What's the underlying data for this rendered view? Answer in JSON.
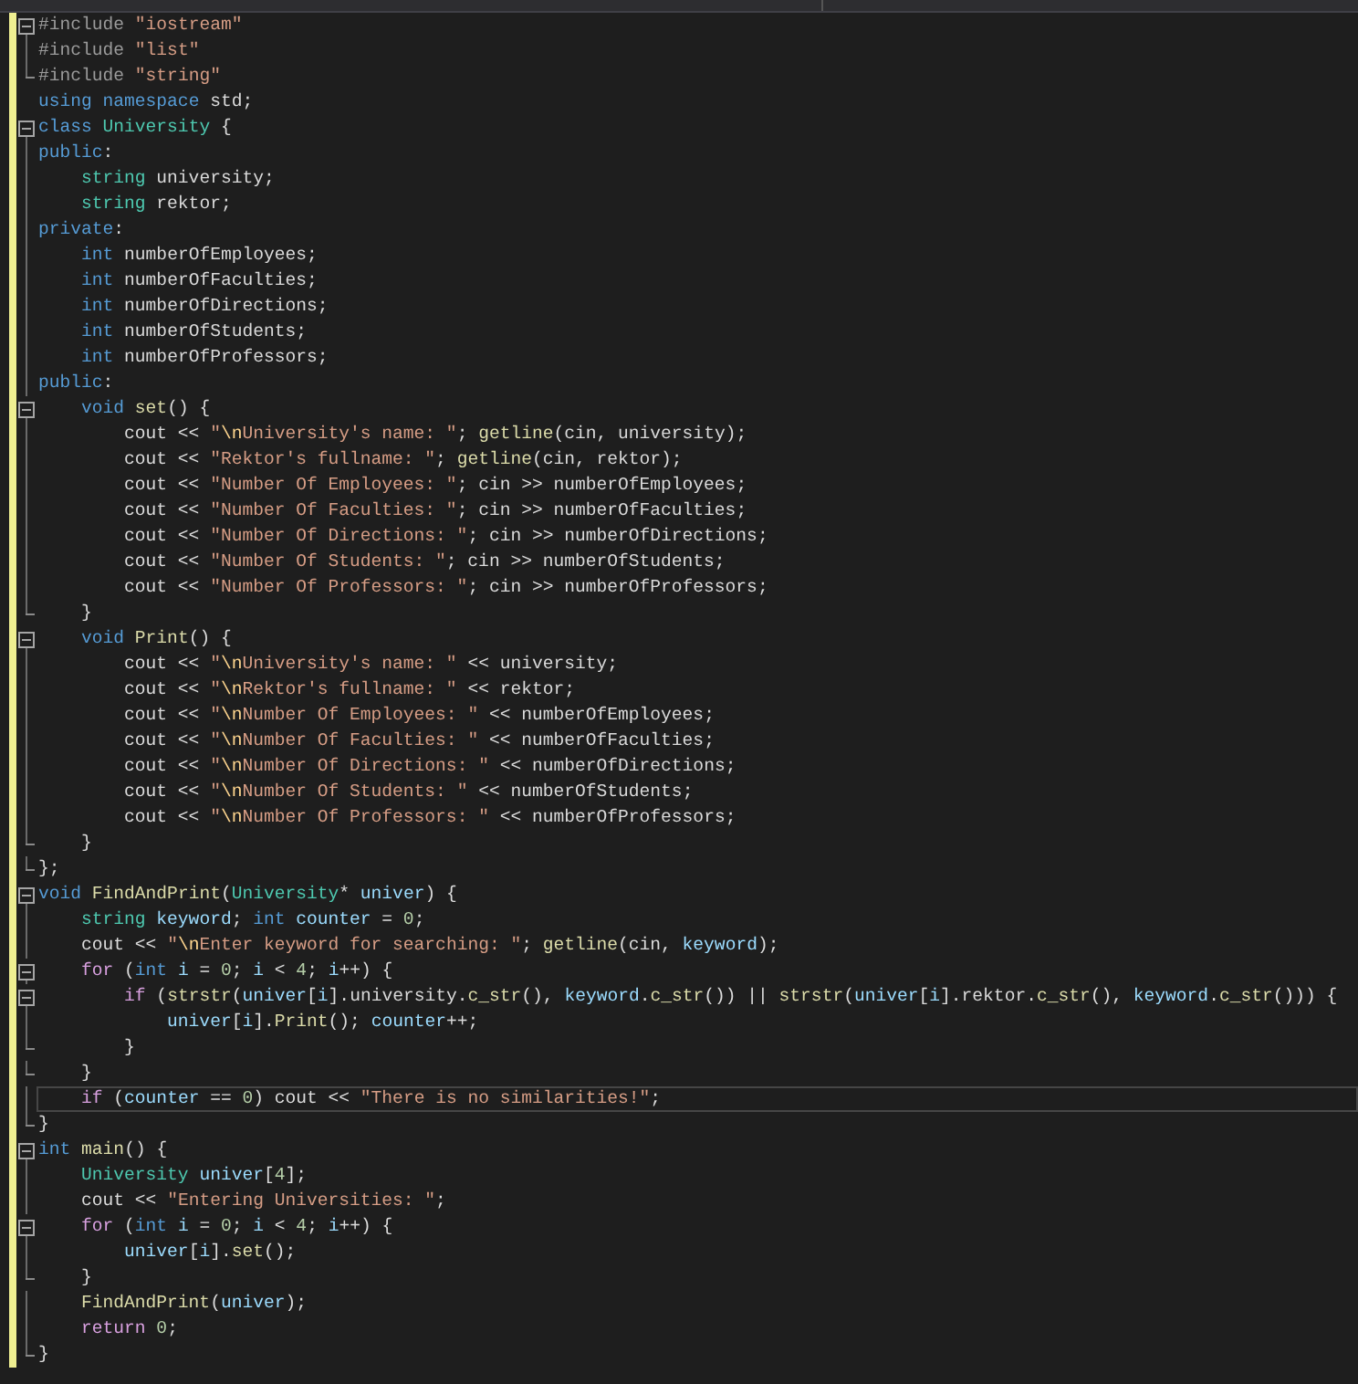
{
  "lines": [
    {
      "collapsible": true,
      "in_block": true,
      "block_end": false,
      "modified": true,
      "current": false,
      "tokens": [
        {
          "kind": "pre",
          "text": "#include "
        },
        {
          "kind": "str",
          "text": "\"iostream\""
        }
      ]
    },
    {
      "collapsible": false,
      "in_block": true,
      "block_end": false,
      "modified": true,
      "current": false,
      "tokens": [
        {
          "kind": "pre",
          "text": "#include "
        },
        {
          "kind": "str",
          "text": "\"list\""
        }
      ]
    },
    {
      "collapsible": false,
      "in_block": true,
      "block_end": true,
      "modified": true,
      "current": false,
      "tokens": [
        {
          "kind": "pre",
          "text": "#include "
        },
        {
          "kind": "str",
          "text": "\"string\""
        }
      ]
    },
    {
      "collapsible": false,
      "in_block": false,
      "block_end": false,
      "modified": true,
      "current": false,
      "tokens": [
        {
          "kind": "kw",
          "text": "using "
        },
        {
          "kind": "kw",
          "text": "namespace"
        },
        {
          "kind": "p",
          "text": " std;"
        }
      ]
    },
    {
      "collapsible": true,
      "in_block": true,
      "block_end": false,
      "modified": true,
      "current": false,
      "tokens": [
        {
          "kind": "kw",
          "text": "class "
        },
        {
          "kind": "type",
          "text": "University"
        },
        {
          "kind": "p",
          "text": " {"
        }
      ]
    },
    {
      "collapsible": false,
      "in_block": true,
      "block_end": false,
      "modified": true,
      "current": false,
      "tokens": [
        {
          "kind": "kw",
          "text": "public"
        },
        {
          "kind": "p",
          "text": ":"
        }
      ]
    },
    {
      "collapsible": false,
      "in_block": true,
      "block_end": false,
      "modified": true,
      "current": false,
      "tokens": [
        {
          "kind": "type",
          "text": "    string "
        },
        {
          "kind": "mem",
          "text": "university"
        },
        {
          "kind": "p",
          "text": ";"
        }
      ]
    },
    {
      "collapsible": false,
      "in_block": true,
      "block_end": false,
      "modified": true,
      "current": false,
      "tokens": [
        {
          "kind": "type",
          "text": "    string "
        },
        {
          "kind": "mem",
          "text": "rektor"
        },
        {
          "kind": "p",
          "text": ";"
        }
      ]
    },
    {
      "collapsible": false,
      "in_block": true,
      "block_end": false,
      "modified": true,
      "current": false,
      "tokens": [
        {
          "kind": "kw",
          "text": "private"
        },
        {
          "kind": "p",
          "text": ":"
        }
      ]
    },
    {
      "collapsible": false,
      "in_block": true,
      "block_end": false,
      "modified": true,
      "current": false,
      "tokens": [
        {
          "kind": "kw",
          "text": "    int "
        },
        {
          "kind": "mem",
          "text": "numberOfEmployees"
        },
        {
          "kind": "p",
          "text": ";"
        }
      ]
    },
    {
      "collapsible": false,
      "in_block": true,
      "block_end": false,
      "modified": true,
      "current": false,
      "tokens": [
        {
          "kind": "kw",
          "text": "    int "
        },
        {
          "kind": "mem",
          "text": "numberOfFaculties"
        },
        {
          "kind": "p",
          "text": ";"
        }
      ]
    },
    {
      "collapsible": false,
      "in_block": true,
      "block_end": false,
      "modified": true,
      "current": false,
      "tokens": [
        {
          "kind": "kw",
          "text": "    int "
        },
        {
          "kind": "mem",
          "text": "numberOfDirections"
        },
        {
          "kind": "p",
          "text": ";"
        }
      ]
    },
    {
      "collapsible": false,
      "in_block": true,
      "block_end": false,
      "modified": true,
      "current": false,
      "tokens": [
        {
          "kind": "kw",
          "text": "    int "
        },
        {
          "kind": "mem",
          "text": "numberOfStudents"
        },
        {
          "kind": "p",
          "text": ";"
        }
      ]
    },
    {
      "collapsible": false,
      "in_block": true,
      "block_end": false,
      "modified": true,
      "current": false,
      "tokens": [
        {
          "kind": "kw",
          "text": "    int "
        },
        {
          "kind": "mem",
          "text": "numberOfProfessors"
        },
        {
          "kind": "p",
          "text": ";"
        }
      ]
    },
    {
      "collapsible": false,
      "in_block": true,
      "block_end": false,
      "modified": true,
      "current": false,
      "tokens": [
        {
          "kind": "kw",
          "text": "public"
        },
        {
          "kind": "p",
          "text": ":"
        }
      ]
    },
    {
      "collapsible": true,
      "in_block": true,
      "block_end": false,
      "modified": true,
      "current": false,
      "tokens": [
        {
          "kind": "kw",
          "text": "    void "
        },
        {
          "kind": "fn",
          "text": "set"
        },
        {
          "kind": "p",
          "text": "() {"
        }
      ]
    },
    {
      "collapsible": false,
      "in_block": true,
      "block_end": false,
      "modified": true,
      "current": false,
      "tokens": [
        {
          "kind": "p",
          "text": "        cout << "
        },
        {
          "kind": "str",
          "text": "\""
        },
        {
          "kind": "esc",
          "text": "\\n"
        },
        {
          "kind": "str",
          "text": "University's name: \""
        },
        {
          "kind": "p",
          "text": "; "
        },
        {
          "kind": "fn",
          "text": "getline"
        },
        {
          "kind": "p",
          "text": "(cin, "
        },
        {
          "kind": "mem",
          "text": "university"
        },
        {
          "kind": "p",
          "text": ");"
        }
      ]
    },
    {
      "collapsible": false,
      "in_block": true,
      "block_end": false,
      "modified": true,
      "current": false,
      "tokens": [
        {
          "kind": "p",
          "text": "        cout << "
        },
        {
          "kind": "str",
          "text": "\"Rektor's fullname: \""
        },
        {
          "kind": "p",
          "text": "; "
        },
        {
          "kind": "fn",
          "text": "getline"
        },
        {
          "kind": "p",
          "text": "(cin, "
        },
        {
          "kind": "mem",
          "text": "rektor"
        },
        {
          "kind": "p",
          "text": ");"
        }
      ]
    },
    {
      "collapsible": false,
      "in_block": true,
      "block_end": false,
      "modified": true,
      "current": false,
      "tokens": [
        {
          "kind": "p",
          "text": "        cout << "
        },
        {
          "kind": "str",
          "text": "\"Number Of Employees: \""
        },
        {
          "kind": "p",
          "text": "; cin >> "
        },
        {
          "kind": "mem",
          "text": "numberOfEmployees"
        },
        {
          "kind": "p",
          "text": ";"
        }
      ]
    },
    {
      "collapsible": false,
      "in_block": true,
      "block_end": false,
      "modified": true,
      "current": false,
      "tokens": [
        {
          "kind": "p",
          "text": "        cout << "
        },
        {
          "kind": "str",
          "text": "\"Number Of Faculties: \""
        },
        {
          "kind": "p",
          "text": "; cin >> "
        },
        {
          "kind": "mem",
          "text": "numberOfFaculties"
        },
        {
          "kind": "p",
          "text": ";"
        }
      ]
    },
    {
      "collapsible": false,
      "in_block": true,
      "block_end": false,
      "modified": true,
      "current": false,
      "tokens": [
        {
          "kind": "p",
          "text": "        cout << "
        },
        {
          "kind": "str",
          "text": "\"Number Of Directions: \""
        },
        {
          "kind": "p",
          "text": "; cin >> "
        },
        {
          "kind": "mem",
          "text": "numberOfDirections"
        },
        {
          "kind": "p",
          "text": ";"
        }
      ]
    },
    {
      "collapsible": false,
      "in_block": true,
      "block_end": false,
      "modified": true,
      "current": false,
      "tokens": [
        {
          "kind": "p",
          "text": "        cout << "
        },
        {
          "kind": "str",
          "text": "\"Number Of Students: \""
        },
        {
          "kind": "p",
          "text": "; cin >> "
        },
        {
          "kind": "mem",
          "text": "numberOfStudents"
        },
        {
          "kind": "p",
          "text": ";"
        }
      ]
    },
    {
      "collapsible": false,
      "in_block": true,
      "block_end": false,
      "modified": true,
      "current": false,
      "tokens": [
        {
          "kind": "p",
          "text": "        cout << "
        },
        {
          "kind": "str",
          "text": "\"Number Of Professors: \""
        },
        {
          "kind": "p",
          "text": "; cin >> "
        },
        {
          "kind": "mem",
          "text": "numberOfProfessors"
        },
        {
          "kind": "p",
          "text": ";"
        }
      ]
    },
    {
      "collapsible": false,
      "in_block": true,
      "block_end": true,
      "modified": true,
      "current": false,
      "tokens": [
        {
          "kind": "p",
          "text": "    }"
        }
      ]
    },
    {
      "collapsible": true,
      "in_block": true,
      "block_end": false,
      "modified": true,
      "current": false,
      "tokens": [
        {
          "kind": "kw",
          "text": "    void "
        },
        {
          "kind": "fn",
          "text": "Print"
        },
        {
          "kind": "p",
          "text": "() {"
        }
      ]
    },
    {
      "collapsible": false,
      "in_block": true,
      "block_end": false,
      "modified": true,
      "current": false,
      "tokens": [
        {
          "kind": "p",
          "text": "        cout << "
        },
        {
          "kind": "str",
          "text": "\""
        },
        {
          "kind": "esc",
          "text": "\\n"
        },
        {
          "kind": "str",
          "text": "University's name: \""
        },
        {
          "kind": "p",
          "text": " << "
        },
        {
          "kind": "mem",
          "text": "university"
        },
        {
          "kind": "p",
          "text": ";"
        }
      ]
    },
    {
      "collapsible": false,
      "in_block": true,
      "block_end": false,
      "modified": true,
      "current": false,
      "tokens": [
        {
          "kind": "p",
          "text": "        cout << "
        },
        {
          "kind": "str",
          "text": "\""
        },
        {
          "kind": "esc",
          "text": "\\n"
        },
        {
          "kind": "str",
          "text": "Rektor's fullname: \""
        },
        {
          "kind": "p",
          "text": " << "
        },
        {
          "kind": "mem",
          "text": "rektor"
        },
        {
          "kind": "p",
          "text": ";"
        }
      ]
    },
    {
      "collapsible": false,
      "in_block": true,
      "block_end": false,
      "modified": true,
      "current": false,
      "tokens": [
        {
          "kind": "p",
          "text": "        cout << "
        },
        {
          "kind": "str",
          "text": "\""
        },
        {
          "kind": "esc",
          "text": "\\n"
        },
        {
          "kind": "str",
          "text": "Number Of Employees: \""
        },
        {
          "kind": "p",
          "text": " << "
        },
        {
          "kind": "mem",
          "text": "numberOfEmployees"
        },
        {
          "kind": "p",
          "text": ";"
        }
      ]
    },
    {
      "collapsible": false,
      "in_block": true,
      "block_end": false,
      "modified": true,
      "current": false,
      "tokens": [
        {
          "kind": "p",
          "text": "        cout << "
        },
        {
          "kind": "str",
          "text": "\""
        },
        {
          "kind": "esc",
          "text": "\\n"
        },
        {
          "kind": "str",
          "text": "Number Of Faculties: \""
        },
        {
          "kind": "p",
          "text": " << "
        },
        {
          "kind": "mem",
          "text": "numberOfFaculties"
        },
        {
          "kind": "p",
          "text": ";"
        }
      ]
    },
    {
      "collapsible": false,
      "in_block": true,
      "block_end": false,
      "modified": true,
      "current": false,
      "tokens": [
        {
          "kind": "p",
          "text": "        cout << "
        },
        {
          "kind": "str",
          "text": "\""
        },
        {
          "kind": "esc",
          "text": "\\n"
        },
        {
          "kind": "str",
          "text": "Number Of Directions: \""
        },
        {
          "kind": "p",
          "text": " << "
        },
        {
          "kind": "mem",
          "text": "numberOfDirections"
        },
        {
          "kind": "p",
          "text": ";"
        }
      ]
    },
    {
      "collapsible": false,
      "in_block": true,
      "block_end": false,
      "modified": true,
      "current": false,
      "tokens": [
        {
          "kind": "p",
          "text": "        cout << "
        },
        {
          "kind": "str",
          "text": "\""
        },
        {
          "kind": "esc",
          "text": "\\n"
        },
        {
          "kind": "str",
          "text": "Number Of Students: \""
        },
        {
          "kind": "p",
          "text": " << "
        },
        {
          "kind": "mem",
          "text": "numberOfStudents"
        },
        {
          "kind": "p",
          "text": ";"
        }
      ]
    },
    {
      "collapsible": false,
      "in_block": true,
      "block_end": false,
      "modified": true,
      "current": false,
      "tokens": [
        {
          "kind": "p",
          "text": "        cout << "
        },
        {
          "kind": "str",
          "text": "\""
        },
        {
          "kind": "esc",
          "text": "\\n"
        },
        {
          "kind": "str",
          "text": "Number Of Professors: \""
        },
        {
          "kind": "p",
          "text": " << "
        },
        {
          "kind": "mem",
          "text": "numberOfProfessors"
        },
        {
          "kind": "p",
          "text": ";"
        }
      ]
    },
    {
      "collapsible": false,
      "in_block": true,
      "block_end": true,
      "modified": true,
      "current": false,
      "tokens": [
        {
          "kind": "p",
          "text": "    }"
        }
      ]
    },
    {
      "collapsible": false,
      "in_block": true,
      "block_end": true,
      "modified": true,
      "current": false,
      "tokens": [
        {
          "kind": "p",
          "text": "};"
        }
      ]
    },
    {
      "collapsible": true,
      "in_block": true,
      "block_end": false,
      "modified": true,
      "current": false,
      "tokens": [
        {
          "kind": "kw",
          "text": "void "
        },
        {
          "kind": "fn",
          "text": "FindAndPrint"
        },
        {
          "kind": "p",
          "text": "("
        },
        {
          "kind": "type",
          "text": "University"
        },
        {
          "kind": "p",
          "text": "* "
        },
        {
          "kind": "var",
          "text": "univer"
        },
        {
          "kind": "p",
          "text": ") {"
        }
      ]
    },
    {
      "collapsible": false,
      "in_block": true,
      "block_end": false,
      "modified": true,
      "current": false,
      "tokens": [
        {
          "kind": "type",
          "text": "    string "
        },
        {
          "kind": "var",
          "text": "keyword"
        },
        {
          "kind": "p",
          "text": "; "
        },
        {
          "kind": "kw",
          "text": "int "
        },
        {
          "kind": "var",
          "text": "counter"
        },
        {
          "kind": "p",
          "text": " = "
        },
        {
          "kind": "num",
          "text": "0"
        },
        {
          "kind": "p",
          "text": ";"
        }
      ]
    },
    {
      "collapsible": false,
      "in_block": true,
      "block_end": false,
      "modified": true,
      "current": false,
      "tokens": [
        {
          "kind": "p",
          "text": "    cout << "
        },
        {
          "kind": "str",
          "text": "\""
        },
        {
          "kind": "esc",
          "text": "\\n"
        },
        {
          "kind": "str",
          "text": "Enter keyword for searching: \""
        },
        {
          "kind": "p",
          "text": "; "
        },
        {
          "kind": "fn",
          "text": "getline"
        },
        {
          "kind": "p",
          "text": "(cin, "
        },
        {
          "kind": "var",
          "text": "keyword"
        },
        {
          "kind": "p",
          "text": ");"
        }
      ]
    },
    {
      "collapsible": true,
      "in_block": true,
      "block_end": false,
      "modified": true,
      "current": false,
      "tokens": [
        {
          "kind": "ctrl",
          "text": "    for"
        },
        {
          "kind": "p",
          "text": " ("
        },
        {
          "kind": "kw",
          "text": "int "
        },
        {
          "kind": "var",
          "text": "i"
        },
        {
          "kind": "p",
          "text": " = "
        },
        {
          "kind": "num",
          "text": "0"
        },
        {
          "kind": "p",
          "text": "; "
        },
        {
          "kind": "var",
          "text": "i"
        },
        {
          "kind": "p",
          "text": " < "
        },
        {
          "kind": "num",
          "text": "4"
        },
        {
          "kind": "p",
          "text": "; "
        },
        {
          "kind": "var",
          "text": "i"
        },
        {
          "kind": "p",
          "text": "++) {"
        }
      ]
    },
    {
      "collapsible": true,
      "in_block": true,
      "block_end": false,
      "modified": true,
      "current": false,
      "tokens": [
        {
          "kind": "ctrl",
          "text": "        if"
        },
        {
          "kind": "p",
          "text": " ("
        },
        {
          "kind": "fn",
          "text": "strstr"
        },
        {
          "kind": "p",
          "text": "("
        },
        {
          "kind": "var",
          "text": "univer"
        },
        {
          "kind": "p",
          "text": "["
        },
        {
          "kind": "var",
          "text": "i"
        },
        {
          "kind": "p",
          "text": "]."
        },
        {
          "kind": "mem",
          "text": "university"
        },
        {
          "kind": "p",
          "text": "."
        },
        {
          "kind": "fn",
          "text": "c_str"
        },
        {
          "kind": "p",
          "text": "(), "
        },
        {
          "kind": "var",
          "text": "keyword"
        },
        {
          "kind": "p",
          "text": "."
        },
        {
          "kind": "fn",
          "text": "c_str"
        },
        {
          "kind": "p",
          "text": "()) || "
        },
        {
          "kind": "fn",
          "text": "strstr"
        },
        {
          "kind": "p",
          "text": "("
        },
        {
          "kind": "var",
          "text": "univer"
        },
        {
          "kind": "p",
          "text": "["
        },
        {
          "kind": "var",
          "text": "i"
        },
        {
          "kind": "p",
          "text": "]."
        },
        {
          "kind": "mem",
          "text": "rektor"
        },
        {
          "kind": "p",
          "text": "."
        },
        {
          "kind": "fn",
          "text": "c_str"
        },
        {
          "kind": "p",
          "text": "(), "
        },
        {
          "kind": "var",
          "text": "keyword"
        },
        {
          "kind": "p",
          "text": "."
        },
        {
          "kind": "fn",
          "text": "c_str"
        },
        {
          "kind": "p",
          "text": "())) {"
        }
      ]
    },
    {
      "collapsible": false,
      "in_block": true,
      "block_end": false,
      "modified": true,
      "current": false,
      "tokens": [
        {
          "kind": "var",
          "text": "            univer"
        },
        {
          "kind": "p",
          "text": "["
        },
        {
          "kind": "var",
          "text": "i"
        },
        {
          "kind": "p",
          "text": "]."
        },
        {
          "kind": "fn",
          "text": "Print"
        },
        {
          "kind": "p",
          "text": "(); "
        },
        {
          "kind": "var",
          "text": "counter"
        },
        {
          "kind": "p",
          "text": "++;"
        }
      ]
    },
    {
      "collapsible": false,
      "in_block": true,
      "block_end": true,
      "modified": true,
      "current": false,
      "tokens": [
        {
          "kind": "p",
          "text": "        }"
        }
      ]
    },
    {
      "collapsible": false,
      "in_block": true,
      "block_end": true,
      "modified": true,
      "current": false,
      "tokens": [
        {
          "kind": "p",
          "text": "    }"
        }
      ]
    },
    {
      "collapsible": false,
      "in_block": true,
      "block_end": false,
      "modified": true,
      "current": true,
      "tokens": [
        {
          "kind": "ctrl",
          "text": "    if"
        },
        {
          "kind": "p",
          "text": " ("
        },
        {
          "kind": "var",
          "text": "counter"
        },
        {
          "kind": "p",
          "text": " == "
        },
        {
          "kind": "num",
          "text": "0"
        },
        {
          "kind": "p",
          "text": ") cout << "
        },
        {
          "kind": "str",
          "text": "\"There is no similarities!\""
        },
        {
          "kind": "p",
          "text": ";"
        }
      ]
    },
    {
      "collapsible": false,
      "in_block": true,
      "block_end": true,
      "modified": true,
      "current": false,
      "tokens": [
        {
          "kind": "p",
          "text": "}"
        }
      ]
    },
    {
      "collapsible": true,
      "in_block": true,
      "block_end": false,
      "modified": true,
      "current": false,
      "tokens": [
        {
          "kind": "kw",
          "text": "int "
        },
        {
          "kind": "fn",
          "text": "main"
        },
        {
          "kind": "p",
          "text": "() {"
        }
      ]
    },
    {
      "collapsible": false,
      "in_block": true,
      "block_end": false,
      "modified": true,
      "current": false,
      "tokens": [
        {
          "kind": "type",
          "text": "    University "
        },
        {
          "kind": "var",
          "text": "univer"
        },
        {
          "kind": "p",
          "text": "["
        },
        {
          "kind": "num",
          "text": "4"
        },
        {
          "kind": "p",
          "text": "];"
        }
      ]
    },
    {
      "collapsible": false,
      "in_block": true,
      "block_end": false,
      "modified": true,
      "current": false,
      "tokens": [
        {
          "kind": "p",
          "text": "    cout << "
        },
        {
          "kind": "str",
          "text": "\"Entering Universities: \""
        },
        {
          "kind": "p",
          "text": ";"
        }
      ]
    },
    {
      "collapsible": true,
      "in_block": true,
      "block_end": false,
      "modified": true,
      "current": false,
      "tokens": [
        {
          "kind": "ctrl",
          "text": "    for"
        },
        {
          "kind": "p",
          "text": " ("
        },
        {
          "kind": "kw",
          "text": "int "
        },
        {
          "kind": "var",
          "text": "i"
        },
        {
          "kind": "p",
          "text": " = "
        },
        {
          "kind": "num",
          "text": "0"
        },
        {
          "kind": "p",
          "text": "; "
        },
        {
          "kind": "var",
          "text": "i"
        },
        {
          "kind": "p",
          "text": " < "
        },
        {
          "kind": "num",
          "text": "4"
        },
        {
          "kind": "p",
          "text": "; "
        },
        {
          "kind": "var",
          "text": "i"
        },
        {
          "kind": "p",
          "text": "++) {"
        }
      ]
    },
    {
      "collapsible": false,
      "in_block": true,
      "block_end": false,
      "modified": true,
      "current": false,
      "tokens": [
        {
          "kind": "var",
          "text": "        univer"
        },
        {
          "kind": "p",
          "text": "["
        },
        {
          "kind": "var",
          "text": "i"
        },
        {
          "kind": "p",
          "text": "]."
        },
        {
          "kind": "fn",
          "text": "set"
        },
        {
          "kind": "p",
          "text": "();"
        }
      ]
    },
    {
      "collapsible": false,
      "in_block": true,
      "block_end": true,
      "modified": true,
      "current": false,
      "tokens": [
        {
          "kind": "p",
          "text": "    }"
        }
      ]
    },
    {
      "collapsible": false,
      "in_block": true,
      "block_end": false,
      "modified": true,
      "current": false,
      "tokens": [
        {
          "kind": "fn",
          "text": "    FindAndPrint"
        },
        {
          "kind": "p",
          "text": "("
        },
        {
          "kind": "var",
          "text": "univer"
        },
        {
          "kind": "p",
          "text": ");"
        }
      ]
    },
    {
      "collapsible": false,
      "in_block": true,
      "block_end": false,
      "modified": true,
      "current": false,
      "tokens": [
        {
          "kind": "ctrl",
          "text": "    return "
        },
        {
          "kind": "num",
          "text": "0"
        },
        {
          "kind": "p",
          "text": ";"
        }
      ]
    },
    {
      "collapsible": false,
      "in_block": true,
      "block_end": true,
      "modified": true,
      "current": false,
      "tokens": [
        {
          "kind": "p",
          "text": "}"
        }
      ]
    }
  ]
}
